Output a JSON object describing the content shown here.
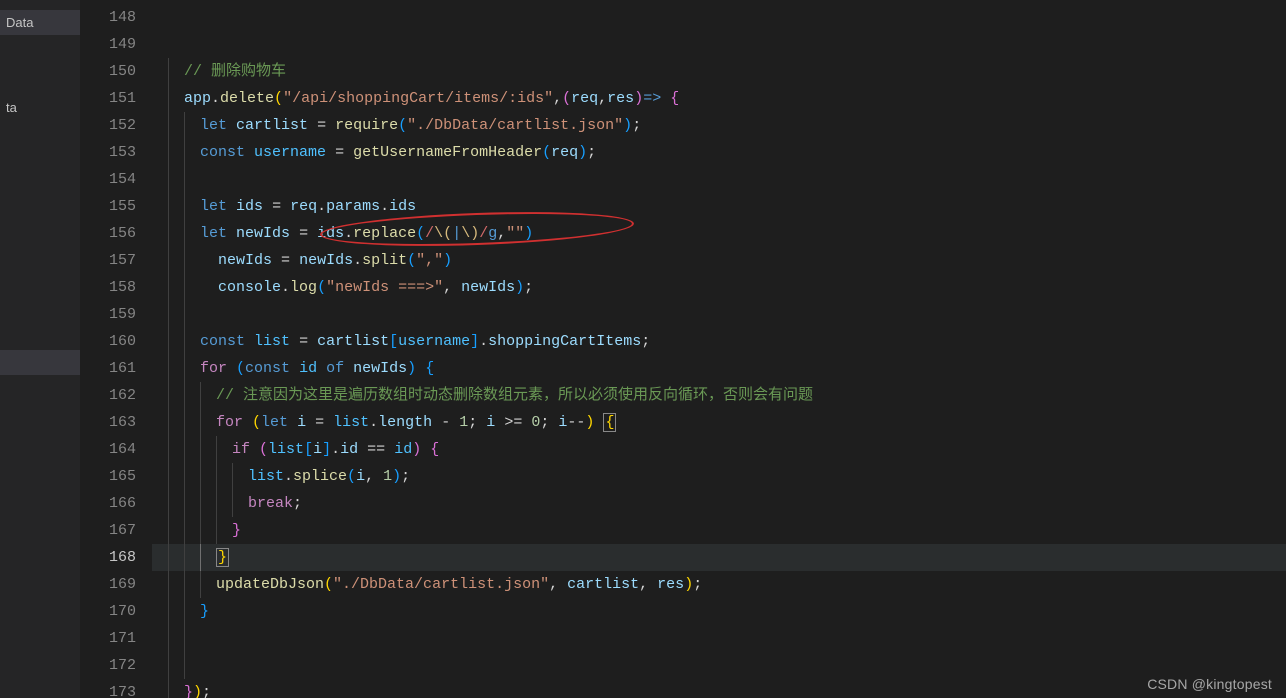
{
  "sidebar": {
    "items": [
      {
        "label": "Data"
      },
      {
        "label": "ta"
      }
    ]
  },
  "watermark": "CSDN @kingtopest",
  "lines": {
    "start": 148,
    "end": 173,
    "current": 168
  },
  "code": {
    "l148": "",
    "l149": "",
    "l150_comment": "// 删除购物车",
    "l151_app": "app",
    "l151_delete": "delete",
    "l151_path": "\"/api/shoppingCart/items/:ids\"",
    "l151_req": "req",
    "l151_res": "res",
    "l152_let": "let",
    "l152_cartlist": "cartlist",
    "l152_require": "require",
    "l152_reqpath": "\"./DbData/cartlist.json\"",
    "l153_const": "const",
    "l153_username": "username",
    "l153_fn": "getUsernameFromHeader",
    "l153_req": "req",
    "l155_let": "let",
    "l155_ids": "ids",
    "l155_req": "req",
    "l155_params": "params",
    "l155_ids2": "ids",
    "l156_let": "let",
    "l156_newIds": "newIds",
    "l156_ids": "ids",
    "l156_replace": "replace",
    "l156_rex": "/\\(|\\)/g",
    "l156_empty": "\"\"",
    "l157_newIds": "newIds",
    "l157_newIds2": "newIds",
    "l157_split": "split",
    "l157_comma": "\",\"",
    "l158_console": "console",
    "l158_log": "log",
    "l158_label": "\"newIds ===>\"",
    "l158_newIds": "newIds",
    "l160_const": "const",
    "l160_list": "list",
    "l160_cartlist": "cartlist",
    "l160_username": "username",
    "l160_items": "shoppingCartItems",
    "l161_for": "for",
    "l161_const": "const",
    "l161_id": "id",
    "l161_of": "of",
    "l161_newIds": "newIds",
    "l162_comment": "// 注意因为这里是遍历数组时动态删除数组元素，所以必须使用反向循环，否则会有问题",
    "l163_for": "for",
    "l163_let": "let",
    "l163_i": "i",
    "l163_list": "list",
    "l163_length": "length",
    "l163_minus1": "1",
    "l163_i2": "i",
    "l163_zero": "0",
    "l163_i3": "i",
    "l164_if": "if",
    "l164_list": "list",
    "l164_i": "i",
    "l164_idp": "id",
    "l164_id": "id",
    "l165_list": "list",
    "l165_splice": "splice",
    "l165_i": "i",
    "l165_one": "1",
    "l166_break": "break",
    "l169_fn": "updateDbJson",
    "l169_path": "\"./DbData/cartlist.json\"",
    "l169_cartlist": "cartlist",
    "l169_res": "res"
  }
}
